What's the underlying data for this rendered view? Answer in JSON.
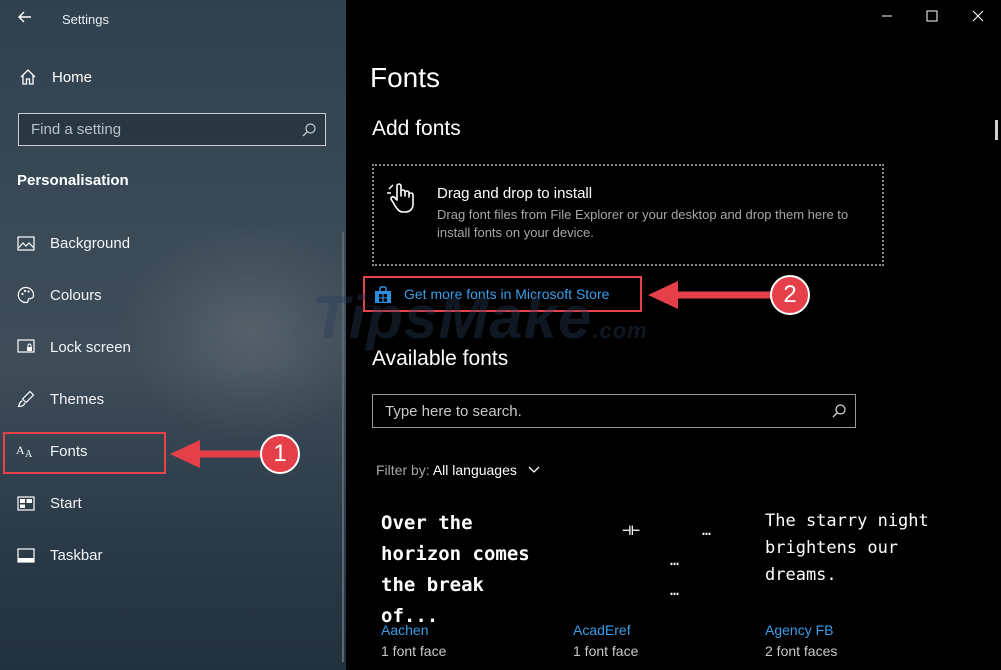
{
  "window": {
    "title": "Settings",
    "controls": {
      "minimize": "—",
      "maximize": "☐",
      "close": "✕"
    }
  },
  "sidebar": {
    "home_label": "Home",
    "search_placeholder": "Find a setting",
    "section_title": "Personalisation",
    "items": [
      {
        "label": "Background",
        "icon": "picture-icon"
      },
      {
        "label": "Colours",
        "icon": "palette-icon"
      },
      {
        "label": "Lock screen",
        "icon": "lock-screen-icon"
      },
      {
        "label": "Themes",
        "icon": "themes-icon"
      },
      {
        "label": "Fonts",
        "icon": "fonts-icon",
        "selected": true
      },
      {
        "label": "Start",
        "icon": "start-icon"
      },
      {
        "label": "Taskbar",
        "icon": "taskbar-icon"
      }
    ]
  },
  "annotations": {
    "badge1": "1",
    "badge2": "2",
    "accent": "#e5404a"
  },
  "main": {
    "page_title": "Fonts",
    "add_fonts_heading": "Add fonts",
    "drop_title": "Drag and drop to install",
    "drop_desc": "Drag font files from File Explorer or your desktop and drop them here to install fonts on your device.",
    "store_link": "Get more fonts in Microsoft Store",
    "available_heading": "Available fonts",
    "search_placeholder": "Type here to search.",
    "filter_label": "Filter by:",
    "filter_value": "All languages",
    "fonts": [
      {
        "name": "Aachen",
        "faces": "1 font face",
        "sample": "Over the horizon comes the break of..."
      },
      {
        "name": "AcadEref",
        "faces": "1 font face",
        "sample": ""
      },
      {
        "name": "Agency FB",
        "faces": "2 font faces",
        "sample": "The starry night brightens our dreams."
      }
    ]
  },
  "watermark": {
    "text": "TipsMake",
    "suffix": ".com"
  },
  "colors": {
    "link": "#3a9ee8",
    "highlight": "#e8424b",
    "background": "#000000"
  }
}
